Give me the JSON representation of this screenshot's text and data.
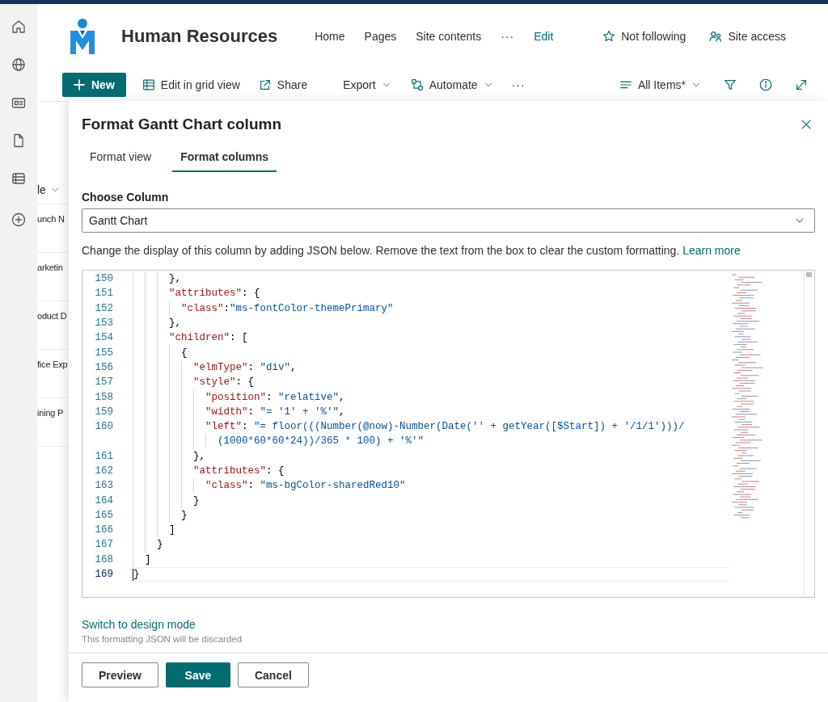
{
  "site": {
    "title": "Human Resources",
    "nav": [
      {
        "label": "Home",
        "kind": "link"
      },
      {
        "label": "Pages",
        "kind": "link"
      },
      {
        "label": "Site contents",
        "kind": "link"
      },
      {
        "label": "···",
        "kind": "more"
      },
      {
        "label": "Edit",
        "kind": "accent"
      }
    ],
    "actions": [
      {
        "label": "Not following",
        "kind": "star"
      },
      {
        "label": "Site access",
        "kind": "people"
      }
    ]
  },
  "command_bar": {
    "left": [
      {
        "label": "New",
        "kind": "primary"
      },
      {
        "label": "Edit in grid view",
        "kind": "grid"
      },
      {
        "label": "Share",
        "kind": "share"
      },
      {
        "label": "Export",
        "kind": "dropdown"
      },
      {
        "label": "Automate",
        "kind": "automate"
      },
      {
        "label": "···",
        "kind": "more"
      }
    ],
    "right": [
      {
        "label": "All Items*",
        "kind": "view"
      },
      {
        "kind": "filter"
      },
      {
        "kind": "info"
      },
      {
        "kind": "expand"
      }
    ]
  },
  "list_behind": {
    "column": "le",
    "rows": [
      "unch N",
      "arketin",
      "oduct D",
      "fice Exp",
      "ining P"
    ]
  },
  "panel": {
    "title": "Format Gantt Chart column",
    "tabs": [
      {
        "label": "Format view",
        "selected": false
      },
      {
        "label": "Format columns",
        "selected": true
      }
    ],
    "choose_label": "Choose Column",
    "column_select": {
      "value": "Gantt Chart"
    },
    "description": "Change the display of this column by adding JSON below. Remove the text from the box to clear the custom formatting.",
    "learn_more": "Learn more",
    "code_lines": [
      {
        "number": "150",
        "current": false,
        "parts": [
          {
            "kind": "punct",
            "text": "      },"
          }
        ]
      },
      {
        "number": "151",
        "current": false,
        "parts": [
          {
            "kind": "key",
            "text": "      \"attributes\""
          },
          {
            "kind": "punct",
            "text": ": {"
          }
        ]
      },
      {
        "number": "152",
        "current": false,
        "parts": [
          {
            "kind": "key",
            "text": "        \"class\""
          },
          {
            "kind": "punct",
            "text": ":"
          },
          {
            "kind": "string",
            "text": "\"ms-fontColor-themePrimary\""
          }
        ]
      },
      {
        "number": "153",
        "current": false,
        "parts": [
          {
            "kind": "punct",
            "text": "      },"
          }
        ]
      },
      {
        "number": "154",
        "current": false,
        "parts": [
          {
            "kind": "key",
            "text": "      \"children\""
          },
          {
            "kind": "punct",
            "text": ": ["
          }
        ]
      },
      {
        "number": "155",
        "current": false,
        "parts": [
          {
            "kind": "punct",
            "text": "        {"
          }
        ]
      },
      {
        "number": "156",
        "current": false,
        "parts": [
          {
            "kind": "key",
            "text": "          \"elmType\""
          },
          {
            "kind": "punct",
            "text": ": "
          },
          {
            "kind": "string",
            "text": "\"div\""
          },
          {
            "kind": "punct",
            "text": ","
          }
        ]
      },
      {
        "number": "157",
        "current": false,
        "parts": [
          {
            "kind": "key",
            "text": "          \"style\""
          },
          {
            "kind": "punct",
            "text": ": {"
          }
        ]
      },
      {
        "number": "158",
        "current": false,
        "parts": [
          {
            "kind": "key",
            "text": "            \"position\""
          },
          {
            "kind": "punct",
            "text": ": "
          },
          {
            "kind": "string",
            "text": "\"relative\""
          },
          {
            "kind": "punct",
            "text": ","
          }
        ]
      },
      {
        "number": "159",
        "current": false,
        "parts": [
          {
            "kind": "key",
            "text": "            \"width\""
          },
          {
            "kind": "punct",
            "text": ": "
          },
          {
            "kind": "string",
            "text": "\"= '1' + '%'\""
          },
          {
            "kind": "punct",
            "text": ","
          }
        ]
      },
      {
        "number": "160",
        "current": false,
        "parts": [
          {
            "kind": "key",
            "text": "            \"left\""
          },
          {
            "kind": "punct",
            "text": ": "
          },
          {
            "kind": "string",
            "text": "\"= floor(((Number(@now)-Number(Date('' + getYear([$Start]) + '/1/1')))/"
          }
        ]
      },
      {
        "current": false,
        "parts": [
          {
            "kind": "string",
            "text": "              (1000*60*60*24))/365 * 100) + '%'\""
          }
        ]
      },
      {
        "number": "161",
        "current": false,
        "parts": [
          {
            "kind": "punct",
            "text": "          },"
          }
        ]
      },
      {
        "number": "162",
        "current": false,
        "parts": [
          {
            "kind": "key",
            "text": "          \"attributes\""
          },
          {
            "kind": "punct",
            "text": ": {"
          }
        ]
      },
      {
        "number": "163",
        "current": false,
        "parts": [
          {
            "kind": "key",
            "text": "            \"class\""
          },
          {
            "kind": "punct",
            "text": ": "
          },
          {
            "kind": "string",
            "text": "\"ms-bgColor-sharedRed10\""
          }
        ]
      },
      {
        "number": "164",
        "current": false,
        "parts": [
          {
            "kind": "punct",
            "text": "          }"
          }
        ]
      },
      {
        "number": "165",
        "current": false,
        "parts": [
          {
            "kind": "punct",
            "text": "        }"
          }
        ]
      },
      {
        "number": "166",
        "current": false,
        "parts": [
          {
            "kind": "punct",
            "text": "      ]"
          }
        ]
      },
      {
        "number": "167",
        "current": false,
        "parts": [
          {
            "kind": "punct",
            "text": "    }"
          }
        ]
      },
      {
        "number": "168",
        "current": false,
        "parts": [
          {
            "kind": "punct",
            "text": "  ]"
          }
        ]
      },
      {
        "number": "169",
        "current": true,
        "parts": [
          {
            "kind": "punct",
            "text": "}"
          }
        ]
      }
    ],
    "switch_link": "Switch to design mode",
    "switch_note": "This formatting JSON will be discarded",
    "buttons": [
      {
        "label": "Preview",
        "kind": "secondary"
      },
      {
        "label": "Save",
        "kind": "primary"
      },
      {
        "label": "Cancel",
        "kind": "secondary"
      }
    ]
  }
}
